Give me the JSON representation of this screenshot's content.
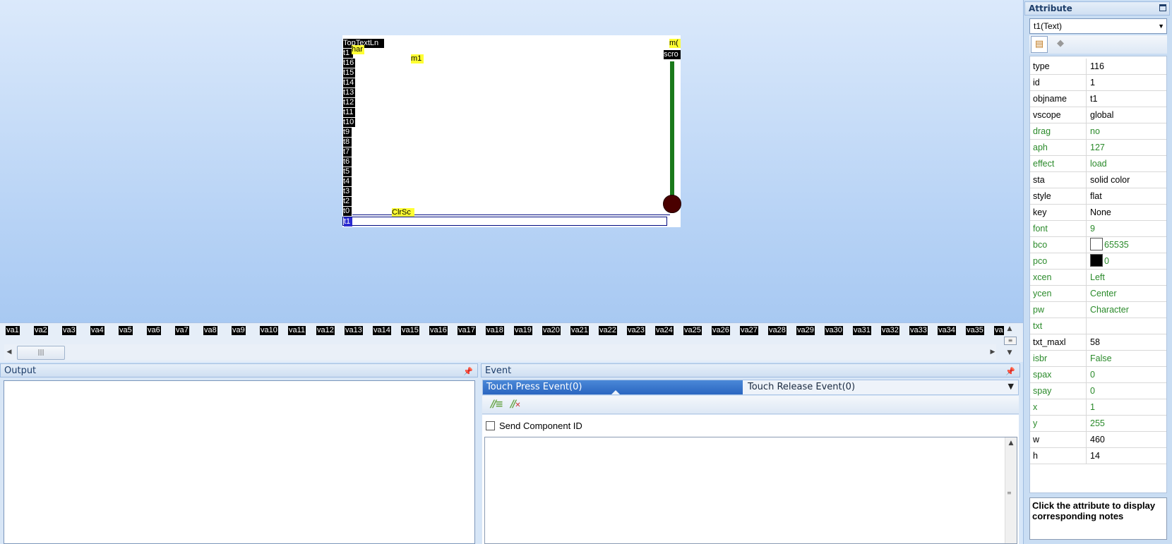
{
  "hmi": {
    "labels_left": [
      "TopTextLn",
      "t1",
      "t16",
      "t15",
      "t14",
      "t13",
      "t12",
      "t11",
      "t10",
      "t9",
      "t8",
      "t7",
      "t6",
      "t5",
      "t4",
      "t3",
      "t2",
      "t0",
      "t1"
    ],
    "har": "har",
    "m1": "m1",
    "m0": "m(",
    "scro": "scro",
    "clrsc": "ClrSc"
  },
  "variables": [
    "va1",
    "va2",
    "va3",
    "va4",
    "va5",
    "va6",
    "va7",
    "va8",
    "va9",
    "va10",
    "va11",
    "va12",
    "va13",
    "va14",
    "va15",
    "va16",
    "va17",
    "va18",
    "va19",
    "va20",
    "va21",
    "va22",
    "va23",
    "va24",
    "va25",
    "va26",
    "va27",
    "va28",
    "va29",
    "va30",
    "va31",
    "va32",
    "va33",
    "va34",
    "va35",
    "va"
  ],
  "output": {
    "title": "Output"
  },
  "event": {
    "title": "Event",
    "tabs": [
      "Touch Press Event(0)",
      "Touch Release Event(0)"
    ],
    "send_component_id": "Send Component ID"
  },
  "attribute": {
    "title": "Attribute",
    "selected_component": "t1(Text)",
    "rows": [
      {
        "name": "type",
        "value": "116",
        "green": false
      },
      {
        "name": "id",
        "value": "1",
        "green": false
      },
      {
        "name": "objname",
        "value": "t1",
        "green": false
      },
      {
        "name": "vscope",
        "value": "global",
        "green": false
      },
      {
        "name": "drag",
        "value": "no",
        "green": true
      },
      {
        "name": "aph",
        "value": "127",
        "green": true
      },
      {
        "name": "effect",
        "value": "load",
        "green": true
      },
      {
        "name": "sta",
        "value": "solid color",
        "green": false
      },
      {
        "name": "style",
        "value": "flat",
        "green": false
      },
      {
        "name": "key",
        "value": "None",
        "green": false
      },
      {
        "name": "font",
        "value": "9",
        "green": true
      },
      {
        "name": "bco",
        "value": "65535",
        "green": true,
        "swatch": "#ffffff"
      },
      {
        "name": "pco",
        "value": "0",
        "green": true,
        "swatch": "#000000"
      },
      {
        "name": "xcen",
        "value": "Left",
        "green": true
      },
      {
        "name": "ycen",
        "value": "Center",
        "green": true
      },
      {
        "name": "pw",
        "value": "Character",
        "green": true
      },
      {
        "name": "txt",
        "value": "",
        "green": true
      },
      {
        "name": "txt_maxl",
        "value": "58",
        "green": false
      },
      {
        "name": "isbr",
        "value": "False",
        "green": true
      },
      {
        "name": "spax",
        "value": "0",
        "green": true
      },
      {
        "name": "spay",
        "value": "0",
        "green": true
      },
      {
        "name": "x",
        "value": "1",
        "green": true
      },
      {
        "name": "y",
        "value": "255",
        "green": true
      },
      {
        "name": "w",
        "value": "460",
        "green": false
      },
      {
        "name": "h",
        "value": "14",
        "green": false
      }
    ],
    "notes": "Click the attribute to display corresponding notes"
  },
  "colors": {
    "accent": "#2a66c0",
    "attr_green": "#2a8a2a",
    "scroll_green": "#1a7a1a",
    "knob": "#4a0000",
    "label_yellow": "#ffff33"
  }
}
